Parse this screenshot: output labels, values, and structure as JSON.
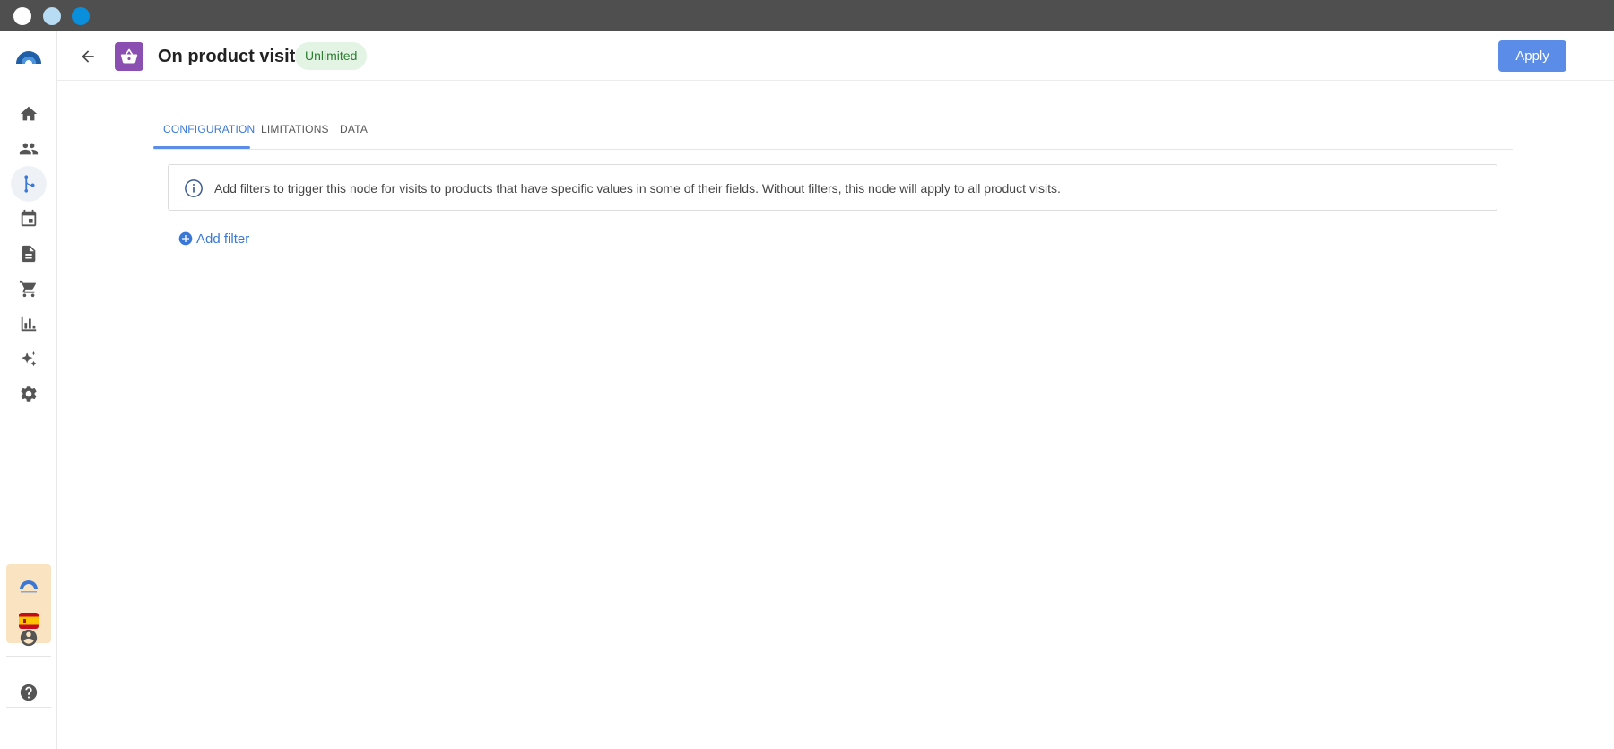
{
  "header": {
    "title": "On product visit",
    "badge": "Unlimited",
    "apply_label": "Apply"
  },
  "tabs": [
    {
      "label": "CONFIGURATION",
      "active": true
    },
    {
      "label": "LIMITATIONS",
      "active": false
    },
    {
      "label": "DATA",
      "active": false
    }
  ],
  "info": {
    "text": "Add filters to trigger this node for visits to products that have specific values in some of their fields. Without filters, this node will apply to all product visits."
  },
  "actions": {
    "add_filter_label": "Add filter"
  },
  "sidebar": {
    "items": [
      {
        "icon": "home-icon"
      },
      {
        "icon": "people-icon"
      },
      {
        "icon": "flow-icon",
        "active": true
      },
      {
        "icon": "calendar-icon"
      },
      {
        "icon": "document-icon"
      },
      {
        "icon": "cart-icon"
      },
      {
        "icon": "bar-chart-icon"
      },
      {
        "icon": "sparkles-icon"
      },
      {
        "icon": "gear-icon"
      }
    ]
  },
  "colors": {
    "accent": "#5b8de8",
    "node_icon": "#8a4fb0",
    "badge_bg": "#e3f4e4",
    "badge_text": "#2e7d32",
    "titlebar": "#4f4f4f"
  }
}
